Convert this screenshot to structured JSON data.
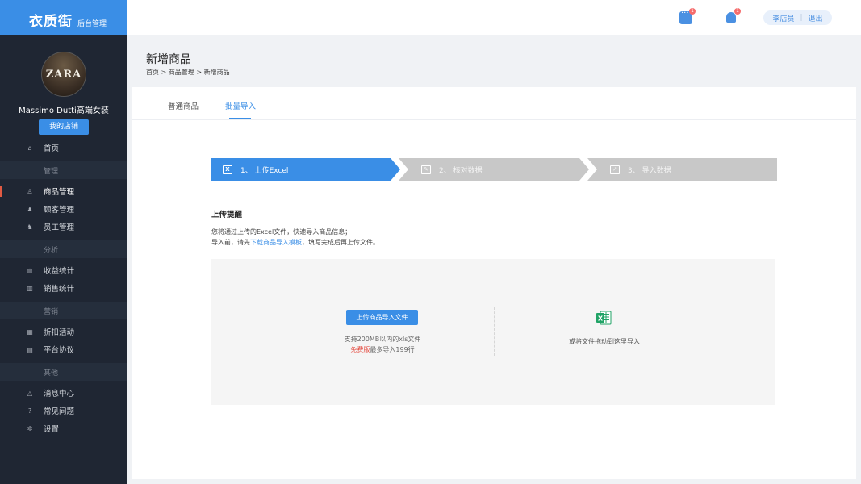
{
  "brand": {
    "name": "衣质街",
    "subtitle": "后台管理",
    "color": "#3a8ee6"
  },
  "profile": {
    "avatar_text": "ZARA",
    "shop_name": "Massimo Dutti高端女装",
    "shop_button": "我的店铺"
  },
  "sidebar": {
    "items": [
      {
        "type": "item",
        "label": "首页",
        "icon": "home-icon"
      },
      {
        "type": "group",
        "label": "管理"
      },
      {
        "type": "item",
        "label": "商品管理",
        "icon": "shirt-icon",
        "active": true
      },
      {
        "type": "item",
        "label": "顾客管理",
        "icon": "user-icon"
      },
      {
        "type": "item",
        "label": "员工管理",
        "icon": "users-icon"
      },
      {
        "type": "group",
        "label": "分析"
      },
      {
        "type": "item",
        "label": "收益统计",
        "icon": "money-bag-icon"
      },
      {
        "type": "item",
        "label": "销售统计",
        "icon": "bar-chart-icon"
      },
      {
        "type": "group",
        "label": "营销"
      },
      {
        "type": "item",
        "label": "折扣活动",
        "icon": "gift-icon"
      },
      {
        "type": "item",
        "label": "平台协议",
        "icon": "document-icon"
      },
      {
        "type": "group",
        "label": "其他"
      },
      {
        "type": "item",
        "label": "消息中心",
        "icon": "bell-icon"
      },
      {
        "type": "item",
        "label": "常见问题",
        "icon": "question-icon"
      },
      {
        "type": "item",
        "label": "设置",
        "icon": "gear-icon"
      }
    ]
  },
  "topbar": {
    "message_badge": "1",
    "notification_badge": "1",
    "user_name": "李店员",
    "logout": "退出"
  },
  "page": {
    "title": "新增商品",
    "breadcrumb": "首页 > 商品管理 > 新增商品"
  },
  "tabs": [
    {
      "label": "普通商品"
    },
    {
      "label": "批量导入",
      "active": true
    }
  ],
  "steps": [
    {
      "label": "1、 上传Excel",
      "state": "active"
    },
    {
      "label": "2、 核对数据",
      "state": "pending"
    },
    {
      "label": "3、 导入数据",
      "state": "pending"
    }
  ],
  "tips": {
    "title": "上传提醒",
    "line1": "您将通过上传的Excel文件，快速导入商品信息；",
    "line2_prefix": "导入前，请先",
    "line2_link": "下载商品导入模板",
    "line2_suffix": "，填写完成后再上传文件。"
  },
  "upload": {
    "button": "上传商品导入文件",
    "hint1": "支持200MB以内的xls文件",
    "hint2_highlight": "免费版",
    "hint2_rest": "最多导入199行",
    "drag_text": "或将文件拖动到这里导入"
  }
}
